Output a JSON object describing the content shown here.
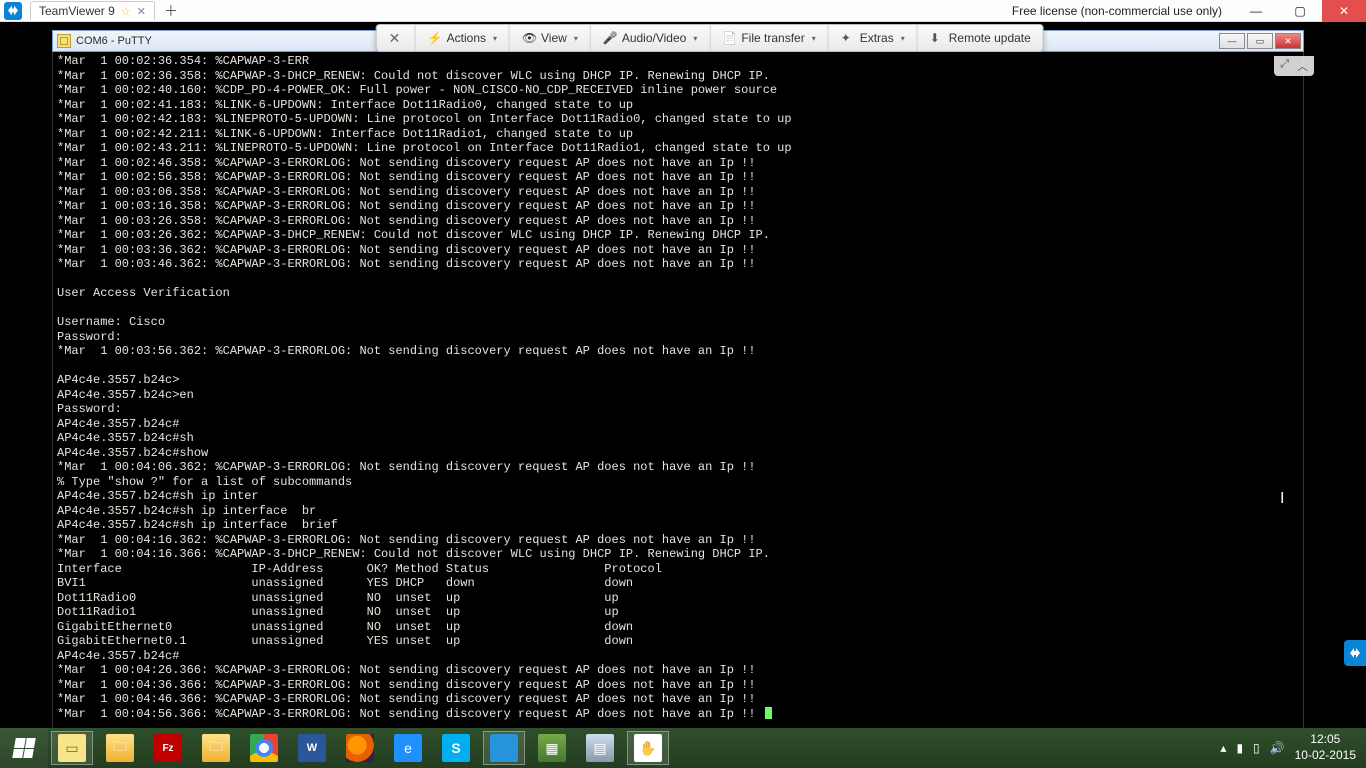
{
  "teamviewer": {
    "tab_title": "TeamViewer 9",
    "license_text": "Free license (non-commercial use only)",
    "toolbar": {
      "close": "✕",
      "actions": "Actions",
      "view": "View",
      "audio_video": "Audio/Video",
      "file_transfer": "File transfer",
      "extras": "Extras",
      "remote_update": "Remote update"
    },
    "mini": {
      "fullscreen": "⤢",
      "collapse": "︿"
    }
  },
  "putty": {
    "title": "COM6 - PuTTY",
    "window_buttons": {
      "min": "—",
      "max": "▭",
      "close": "✕"
    },
    "terminal_lines": [
      "*Mar  1 00:02:36.354: %CAPWAP-3-ERR",
      "*Mar  1 00:02:36.358: %CAPWAP-3-DHCP_RENEW: Could not discover WLC using DHCP IP. Renewing DHCP IP.",
      "*Mar  1 00:02:40.160: %CDP_PD-4-POWER_OK: Full power - NON_CISCO-NO_CDP_RECEIVED inline power source",
      "*Mar  1 00:02:41.183: %LINK-6-UPDOWN: Interface Dot11Radio0, changed state to up",
      "*Mar  1 00:02:42.183: %LINEPROTO-5-UPDOWN: Line protocol on Interface Dot11Radio0, changed state to up",
      "*Mar  1 00:02:42.211: %LINK-6-UPDOWN: Interface Dot11Radio1, changed state to up",
      "*Mar  1 00:02:43.211: %LINEPROTO-5-UPDOWN: Line protocol on Interface Dot11Radio1, changed state to up",
      "*Mar  1 00:02:46.358: %CAPWAP-3-ERRORLOG: Not sending discovery request AP does not have an Ip !!",
      "*Mar  1 00:02:56.358: %CAPWAP-3-ERRORLOG: Not sending discovery request AP does not have an Ip !!",
      "*Mar  1 00:03:06.358: %CAPWAP-3-ERRORLOG: Not sending discovery request AP does not have an Ip !!",
      "*Mar  1 00:03:16.358: %CAPWAP-3-ERRORLOG: Not sending discovery request AP does not have an Ip !!",
      "*Mar  1 00:03:26.358: %CAPWAP-3-ERRORLOG: Not sending discovery request AP does not have an Ip !!",
      "*Mar  1 00:03:26.362: %CAPWAP-3-DHCP_RENEW: Could not discover WLC using DHCP IP. Renewing DHCP IP.",
      "*Mar  1 00:03:36.362: %CAPWAP-3-ERRORLOG: Not sending discovery request AP does not have an Ip !!",
      "*Mar  1 00:03:46.362: %CAPWAP-3-ERRORLOG: Not sending discovery request AP does not have an Ip !!",
      "",
      "User Access Verification",
      "",
      "Username: Cisco",
      "Password:",
      "*Mar  1 00:03:56.362: %CAPWAP-3-ERRORLOG: Not sending discovery request AP does not have an Ip !!",
      "",
      "AP4c4e.3557.b24c>",
      "AP4c4e.3557.b24c>en",
      "Password:",
      "AP4c4e.3557.b24c#",
      "AP4c4e.3557.b24c#sh",
      "AP4c4e.3557.b24c#show",
      "*Mar  1 00:04:06.362: %CAPWAP-3-ERRORLOG: Not sending discovery request AP does not have an Ip !!",
      "% Type \"show ?\" for a list of subcommands",
      "AP4c4e.3557.b24c#sh ip inter",
      "AP4c4e.3557.b24c#sh ip interface  br",
      "AP4c4e.3557.b24c#sh ip interface  brief",
      "*Mar  1 00:04:16.362: %CAPWAP-3-ERRORLOG: Not sending discovery request AP does not have an Ip !!",
      "*Mar  1 00:04:16.366: %CAPWAP-3-DHCP_RENEW: Could not discover WLC using DHCP IP. Renewing DHCP IP.",
      "Interface                  IP-Address      OK? Method Status                Protocol",
      "BVI1                       unassigned      YES DHCP   down                  down",
      "Dot11Radio0                unassigned      NO  unset  up                    up",
      "Dot11Radio1                unassigned      NO  unset  up                    up",
      "GigabitEthernet0           unassigned      NO  unset  up                    down",
      "GigabitEthernet0.1         unassigned      YES unset  up                    down",
      "AP4c4e.3557.b24c#",
      "*Mar  1 00:04:26.366: %CAPWAP-3-ERRORLOG: Not sending discovery request AP does not have an Ip !!",
      "*Mar  1 00:04:36.366: %CAPWAP-3-ERRORLOG: Not sending discovery request AP does not have an Ip !!",
      "*Mar  1 00:04:46.366: %CAPWAP-3-ERRORLOG: Not sending discovery request AP does not have an Ip !!",
      "*Mar  1 00:04:56.366: %CAPWAP-3-ERRORLOG: Not sending discovery request AP does not have an Ip !! "
    ]
  },
  "taskbar": {
    "items": [
      {
        "name": "putty",
        "glyph": "▭"
      },
      {
        "name": "folder1",
        "glyph": "🗀"
      },
      {
        "name": "filezilla",
        "glyph": "Fz"
      },
      {
        "name": "folder2",
        "glyph": "🗀"
      },
      {
        "name": "chrome",
        "glyph": ""
      },
      {
        "name": "word",
        "glyph": "W"
      },
      {
        "name": "firefox",
        "glyph": ""
      },
      {
        "name": "ie",
        "glyph": "e"
      },
      {
        "name": "skype",
        "glyph": "S"
      },
      {
        "name": "teamviewer",
        "glyph": ""
      },
      {
        "name": "winrar",
        "glyph": "▦"
      },
      {
        "name": "notepad",
        "glyph": "▤"
      },
      {
        "name": "hand",
        "glyph": "✋"
      }
    ],
    "tray": {
      "up": "▴",
      "battery": "▮",
      "net": "▯",
      "vol": "🔊",
      "time": "12:05",
      "date": "10-02-2015"
    }
  }
}
